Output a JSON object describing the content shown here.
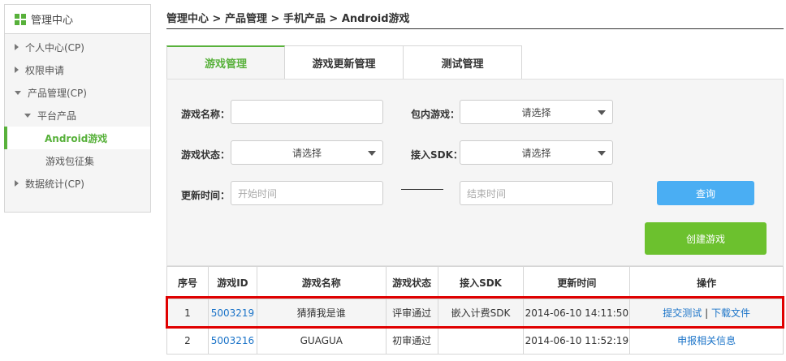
{
  "sidebar": {
    "title": "管理中心",
    "items": [
      {
        "label": "个人中心(CP)"
      },
      {
        "label": "权限申请"
      },
      {
        "label": "产品管理(CP)"
      },
      {
        "label": "平台产品"
      },
      {
        "label": "Android游戏"
      },
      {
        "label": "游戏包征集"
      },
      {
        "label": "数据统计(CP)"
      }
    ]
  },
  "breadcrumb": "管理中心 > 产品管理 > 手机产品 > Android游戏",
  "tabs": [
    "游戏管理",
    "游戏更新管理",
    "测试管理"
  ],
  "filters": {
    "game_name_label": "游戏名称：",
    "game_name_value": "",
    "bundle_label": "包内游戏：",
    "bundle_value": "请选择",
    "status_label": "游戏状态：",
    "status_value": "请选择",
    "sdk_label": "接入SDK：",
    "sdk_value": "请选择",
    "time_label": "更新时间：",
    "start_placeholder": "开始时间",
    "end_placeholder": "结束时间",
    "query_button": "查询",
    "create_button": "创建游戏"
  },
  "table": {
    "headers": [
      "序号",
      "游戏ID",
      "游戏名称",
      "游戏状态",
      "接入SDK",
      "更新时间",
      "操作"
    ],
    "rows": [
      {
        "no": "1",
        "id": "5003219",
        "name": "猜猜我是谁",
        "status": "评审通过",
        "sdk": "嵌入计费SDK",
        "time": "2014-06-10 14:11:50",
        "action1": "提交测试",
        "sep": "|",
        "action2": "下载文件"
      },
      {
        "no": "2",
        "id": "5003216",
        "name": "GUAGUA",
        "status": "初审通过",
        "sdk": "",
        "time": "2014-06-10 11:52:19",
        "action1": "申报相关信息"
      }
    ]
  },
  "colors": {
    "accent_green": "#58b13b",
    "query_blue": "#4aaef3",
    "create_green": "#6cc12e",
    "highlight_red": "#e00000",
    "link_blue": "#1a73c8"
  }
}
